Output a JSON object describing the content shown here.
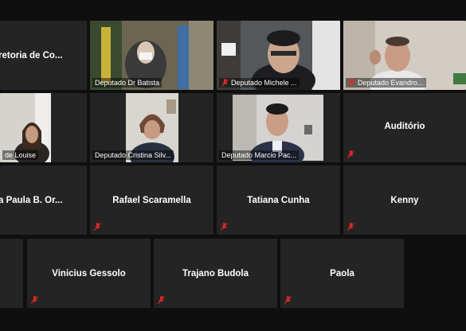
{
  "colors": {
    "tile_bg": "#242424",
    "active_border": "#e8e86a",
    "muted_icon": "#e02828"
  },
  "icons": {
    "muted": "microphone-muted-icon"
  },
  "participants": [
    {
      "name": "retoria de Co...",
      "has_video": false,
      "muted": false,
      "active": false
    },
    {
      "name": "Deputado Dr Batista",
      "has_video": true,
      "muted": false,
      "active": false
    },
    {
      "name": "Deputado Michele ...",
      "has_video": true,
      "muted": true,
      "active": false
    },
    {
      "name": "Deputado Evandro...",
      "has_video": true,
      "muted": true,
      "active": false
    },
    {
      "name": "de Louise",
      "has_video": true,
      "muted": false,
      "active": false
    },
    {
      "name": "Deputado Cristina Silv...",
      "has_video": true,
      "muted": false,
      "active": false
    },
    {
      "name": "Deputado Marcio Pac...",
      "has_video": true,
      "muted": false,
      "active": true
    },
    {
      "name": "Auditório",
      "has_video": false,
      "muted": true,
      "active": false
    },
    {
      "name": "a Paula B. Or...",
      "has_video": false,
      "muted": false,
      "active": false
    },
    {
      "name": "Rafael Scaramella",
      "has_video": false,
      "muted": true,
      "active": false
    },
    {
      "name": "Tatiana Cunha",
      "has_video": false,
      "muted": true,
      "active": false
    },
    {
      "name": "Kenny",
      "has_video": false,
      "muted": true,
      "active": false
    },
    {
      "name": "Vinicius Gessolo",
      "has_video": false,
      "muted": true,
      "active": false
    },
    {
      "name": "Trajano Budola",
      "has_video": false,
      "muted": true,
      "active": false
    },
    {
      "name": "Paola",
      "has_video": false,
      "muted": true,
      "active": false
    }
  ]
}
